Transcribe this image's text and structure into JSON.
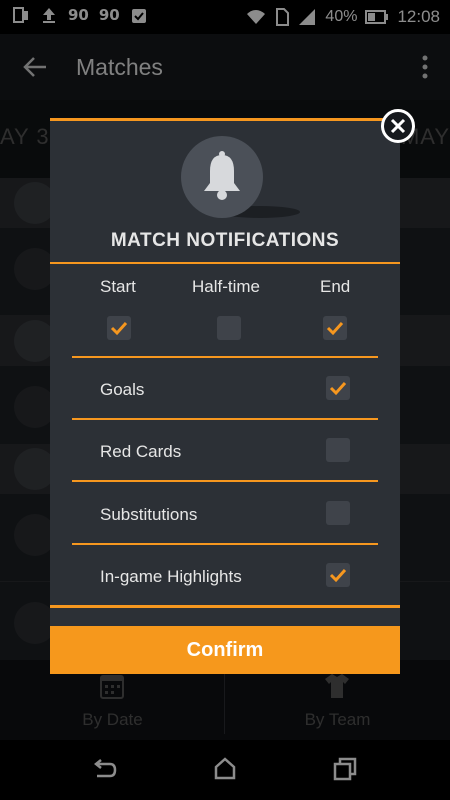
{
  "status_bar": {
    "icons_left": [
      "screen-mirror-icon",
      "upload-icon",
      "app-90-icon",
      "app-90-icon",
      "clipboard-check-icon"
    ],
    "left_texts": [
      "90",
      "90"
    ],
    "battery": "40%",
    "time": "12:08"
  },
  "appbar": {
    "title": "Matches"
  },
  "background": {
    "date_left": "AY 3",
    "date_right": "MAY"
  },
  "bottom_nav": {
    "by_date": "By Date",
    "by_team": "By Team"
  },
  "dialog": {
    "title": "MATCH NOTIFICATIONS",
    "columns": [
      {
        "label": "Start",
        "checked": true
      },
      {
        "label": "Half-time",
        "checked": false
      },
      {
        "label": "End",
        "checked": true
      }
    ],
    "rows": [
      {
        "label": "Goals",
        "checked": true
      },
      {
        "label": "Red Cards",
        "checked": false
      },
      {
        "label": "Substitutions",
        "checked": false
      },
      {
        "label": "In-game Highlights",
        "checked": true
      }
    ],
    "confirm_label": "Confirm"
  },
  "colors": {
    "accent": "#f6971f",
    "dialog_bg": "#2c3036",
    "checkbox_bg": "#3f434a"
  }
}
